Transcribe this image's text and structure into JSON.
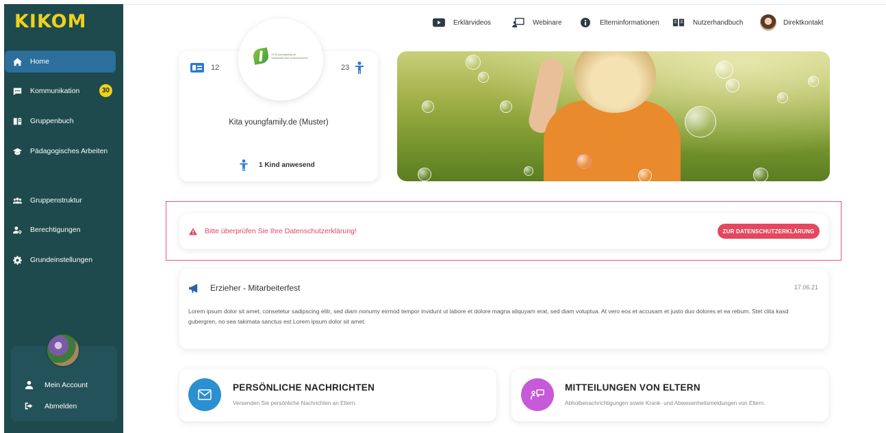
{
  "app": {
    "logo": "KIKOM"
  },
  "sidebar": {
    "items": [
      {
        "label": "Home",
        "icon": "home-icon",
        "active": true
      },
      {
        "label": "Kommunikation",
        "icon": "chat-icon",
        "badge": "30"
      },
      {
        "label": "Gruppenbuch",
        "icon": "book-icon"
      },
      {
        "label": "Pädagogisches Arbeiten",
        "icon": "graduation-cap-icon"
      },
      {
        "label": "Gruppenstruktur",
        "icon": "users-icon"
      },
      {
        "label": "Berechtigungen",
        "icon": "user-key-icon"
      },
      {
        "label": "Grundeinstellungen",
        "icon": "gear-icon"
      }
    ],
    "account": [
      {
        "label": "Mein Account",
        "icon": "user-icon"
      },
      {
        "label": "Abmelden",
        "icon": "logout-icon"
      }
    ]
  },
  "topnav": [
    {
      "label": "Erklärvideos",
      "icon": "youtube-icon"
    },
    {
      "label": "Webinare",
      "icon": "presentation-icon"
    },
    {
      "label": "Elterninformationen",
      "icon": "info-icon"
    },
    {
      "label": "Nutzerhandbuch",
      "icon": "open-book-icon"
    },
    {
      "label": "Direktkontakt",
      "icon": "avatar"
    }
  ],
  "kita": {
    "logo_text": [
      "KITA youngfamily.de",
      "Musterkita des Unternehmens"
    ],
    "staff_count": "12",
    "children_count": "23",
    "name": "Kita youngfamily.de (Muster)",
    "present": "1 Kind anwesend"
  },
  "alert": {
    "text": "Bitte überprüfen Sie Ihre Datenschutzerklärung!",
    "button": "ZUR DATENSCHUTZERKLÄRUNG",
    "color": "#e3485f"
  },
  "news": {
    "title": "Erzieher - Mitarbeiterfest",
    "date": "17.06.21",
    "body": "Lorem ipsum dolor sit amet, consetetur sadipscing elitr, sed diam nonumy eirmod tempor invidunt ut labore et dolore magna aliquyam erat, sed diam voluptua. At vero eos et accusam et justo duo dolores et ea rebum. Stet clita kasd gubergren, no sea takimata sanctus est Lorem ipsum dolor sit amet."
  },
  "features": [
    {
      "title": "PERSÖNLICHE NACHRICHTEN",
      "subtitle": "Versenden Sie persönliche Nachrichten an Eltern.",
      "color": "#2b8fd0",
      "icon": "envelope-icon"
    },
    {
      "title": "MITTEILUNGEN VON ELTERN",
      "subtitle": "Abholbenachrichtigungen sowie Krank- und Abwesenheitsmeldungen von Eltern.",
      "color": "#c75ad8",
      "icon": "parent-message-icon"
    }
  ],
  "colors": {
    "sidebar": "#1e4a4d",
    "active": "#2c6e9c",
    "badge": "#f0d21a",
    "accent_blue": "#2b7bd0"
  }
}
